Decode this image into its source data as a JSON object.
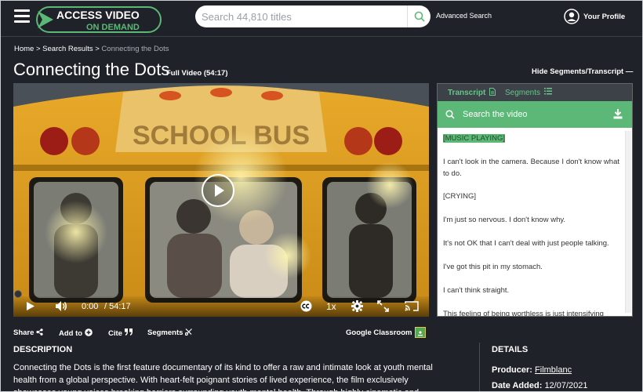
{
  "header": {
    "logo_line1": "ACCESS VIDEO",
    "logo_line2": "ON DEMAND",
    "search_placeholder": "Search 44,810 titles",
    "advanced_search": "Advanced Search",
    "profile": "Your Profile"
  },
  "breadcrumb": {
    "home": "Home",
    "sep1": " > ",
    "results": "Search Results",
    "sep2": " > ",
    "current": "Connecting the Dots"
  },
  "title": {
    "main": "Connecting the Dots",
    "sub": "Full Video (54:17)",
    "hide_segments": "Hide Segments/Transcript —"
  },
  "video": {
    "current_time": "0:00",
    "duration": "/ 54:17",
    "speed": "1x",
    "bus_sign": "SCHOOL BUS"
  },
  "transcript": {
    "tab_transcript": "Transcript",
    "tab_segments": "Segments",
    "search_placeholder": "Search the video",
    "lines": [
      "[MUSIC PLAYING]",
      "I can't look in the camera. Because I don't know what to do.",
      "[CRYING]",
      "I'm just so nervous. I don't know why.",
      "It's not OK that I can't deal with just people talking.",
      "I've got this pit in my stomach.",
      "I can't think straight.",
      "This feeling of being worthless is just intensifying"
    ]
  },
  "actions": {
    "share": "Share",
    "add_to": "Add to",
    "cite": "Cite",
    "segments": "Segments",
    "google_classroom": "Google Classroom"
  },
  "description": {
    "heading": "DESCRIPTION",
    "text": "Connecting the Dots is the first feature documentary of its kind to offer a raw and intimate look at youth mental health from a global perspective. With heart-felt poignant stories of lived experience, the film exclusively showcases young voices breaking barriers surrounding youth mental health. Through highly cinematic and character-driven storytelling"
  },
  "details": {
    "heading": "DETAILS",
    "producer_label": "Producer:",
    "producer_value": "Filmblanc",
    "date_label": "Date Added:",
    "date_value": "12/07/2021"
  },
  "colors": {
    "background": "#1f2229",
    "accent_green": "#5cb876",
    "tab_bar": "#3d4148"
  }
}
